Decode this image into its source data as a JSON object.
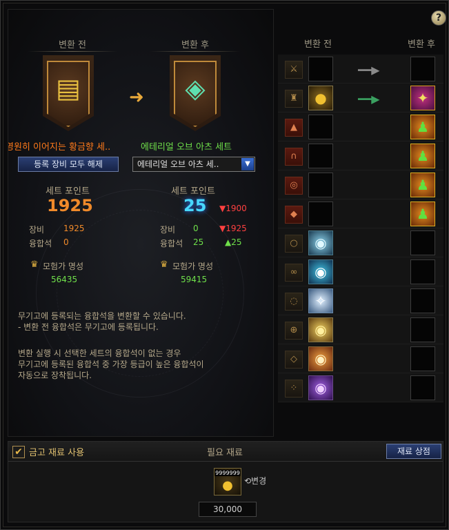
{
  "help": "?",
  "before": {
    "header": "변환 전",
    "set_name": "영원히 이어지는 황금향 세..",
    "button": "등록 장비 모두 해제",
    "set_point_label": "세트 포인트",
    "set_point": "1925",
    "equip_label": "장비",
    "equip_value": "1925",
    "fusion_label": "융합석",
    "fusion_value": "0",
    "fame_label": "모험가 명성",
    "fame_value": "56435",
    "icon": "gold-bars-icon"
  },
  "after": {
    "header": "변환 후",
    "set_name": "에테리얼 오브 아츠 세트",
    "select_value": "에테리얼 오브 아츠 세..",
    "set_point_label": "세트 포인트",
    "set_point": "25",
    "set_point_delta": "▼1900",
    "equip_label": "장비",
    "equip_value": "0",
    "equip_delta": "▼1925",
    "fusion_label": "융합석",
    "fusion_value": "25",
    "fusion_delta": "▲25",
    "fame_label": "모험가 명성",
    "fame_value": "59415",
    "icon": "fox-icon"
  },
  "info": {
    "p1": "무기고에 등록되는 융합석을 변환할 수 있습니다.\n- 변환 전 융합석은 무기고에 등록됩니다.",
    "p2": "변환 실행 시 선택한 세트의 융합석이 없는 경우\n무기고에 등록된 융합석 중 가장 등급이 높은 융합석이\n자동으로 장착됩니다."
  },
  "slots": {
    "header_before": "변환 전",
    "header_after": "변환 후",
    "rows": [
      {
        "slot": "weapon",
        "glyph": "⚔",
        "red": false,
        "before": "",
        "after": "",
        "arrow": "gray"
      },
      {
        "slot": "shoulder",
        "glyph": "♜",
        "red": false,
        "before": "gold-coins",
        "after": "creature-card",
        "arrow": "green"
      },
      {
        "slot": "top",
        "glyph": "▲",
        "red": true,
        "before": "",
        "after": "card",
        "arrow": ""
      },
      {
        "slot": "pants",
        "glyph": "∩",
        "red": true,
        "before": "",
        "after": "card",
        "arrow": ""
      },
      {
        "slot": "belt",
        "glyph": "◎",
        "red": true,
        "before": "",
        "after": "card",
        "arrow": ""
      },
      {
        "slot": "shoes",
        "glyph": "◆",
        "red": true,
        "before": "",
        "after": "card",
        "arrow": ""
      },
      {
        "slot": "ring1",
        "glyph": "○",
        "red": false,
        "before": "orb-blue",
        "after": "",
        "arrow": ""
      },
      {
        "slot": "necklace",
        "glyph": "∞",
        "red": false,
        "before": "orb-cyan",
        "after": "",
        "arrow": ""
      },
      {
        "slot": "ring2",
        "glyph": "◌",
        "red": false,
        "before": "orb-white",
        "after": "",
        "arrow": ""
      },
      {
        "slot": "support",
        "glyph": "⊕",
        "red": false,
        "before": "orb-gold",
        "after": "",
        "arrow": ""
      },
      {
        "slot": "magic-stone",
        "glyph": "◇",
        "red": false,
        "before": "orb-orange",
        "after": "",
        "arrow": ""
      },
      {
        "slot": "earring",
        "glyph": "⁘",
        "red": false,
        "before": "orb-purple",
        "after": "",
        "arrow": ""
      }
    ]
  },
  "bottom": {
    "checkbox_label": "금고 재료 사용",
    "required_label": "필요 재료",
    "shop_button": "재료 상점",
    "material_count": "9999999",
    "change_label": "⟲변경",
    "cost": "30,000"
  }
}
